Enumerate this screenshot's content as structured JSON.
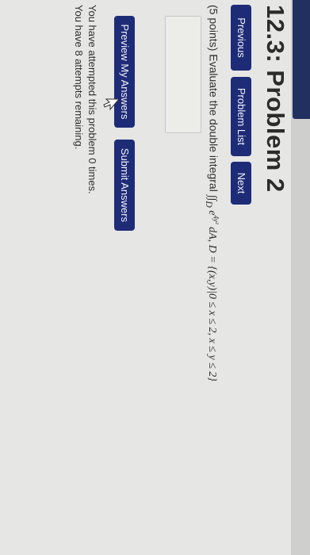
{
  "page": {
    "title": "12.3: Problem 2"
  },
  "nav": {
    "previous": "Previous",
    "problem_list": "Problem List",
    "next": "Next"
  },
  "problem": {
    "points": "(5 points) Evaluate the double integral",
    "integral": "∫∫",
    "region_sub": "D",
    "integrand_base": "e",
    "integrand_exp": "4y²",
    "rest": "dA, D = {(x,y)|0 ≤ x ≤ 2, x ≤ y ≤ 2}"
  },
  "actions": {
    "preview": "Preview My Answers",
    "submit": "Submit Answers"
  },
  "status": {
    "attempted": "You have attempted this problem 0 times.",
    "remaining": "You have 8 attempts remaining."
  },
  "colors": {
    "button": "#1e2c78",
    "sidebar": "#22305f",
    "background": "#e6e6e4"
  }
}
